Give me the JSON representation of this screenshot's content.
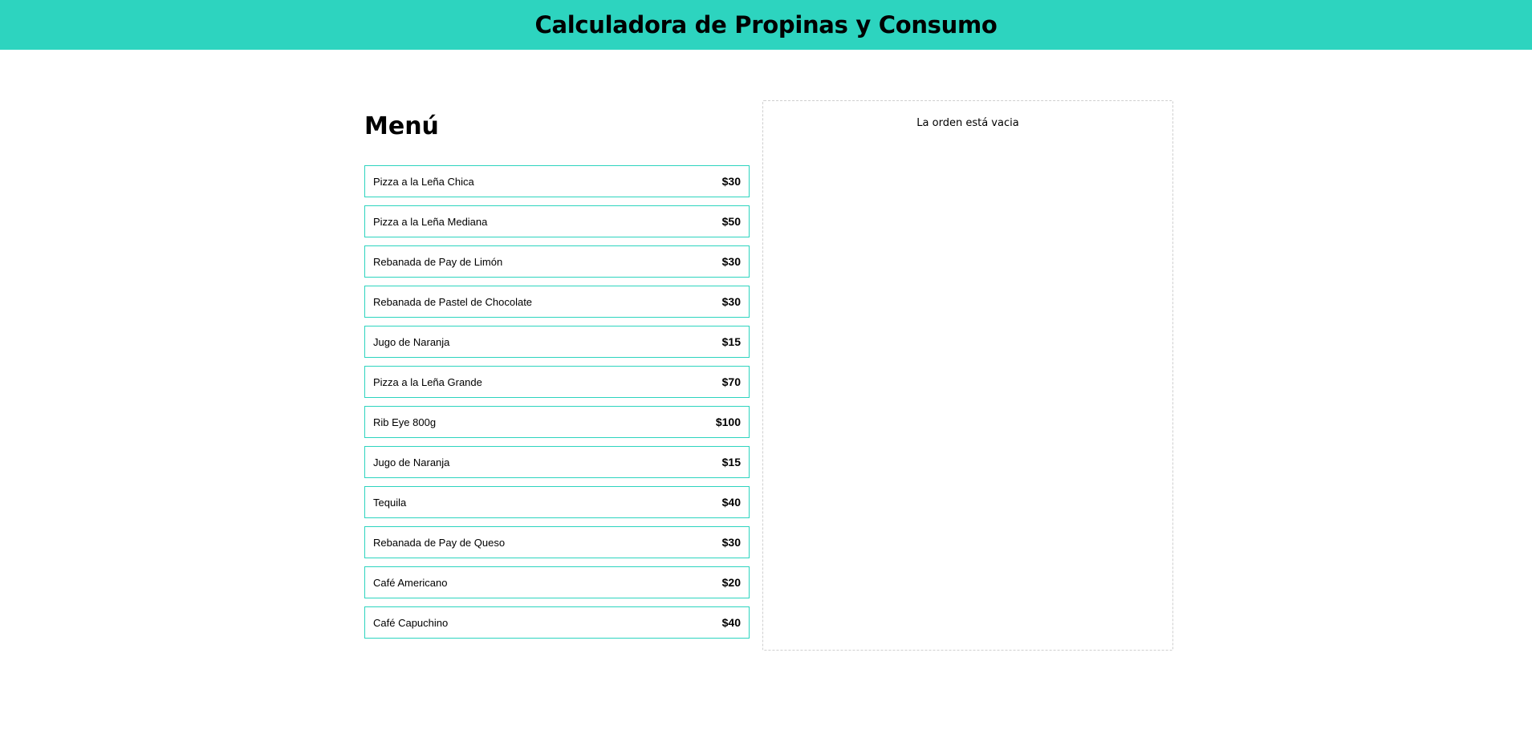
{
  "header": {
    "title": "Calculadora de Propinas y Consumo",
    "background_color": "#2dd4bf"
  },
  "menu": {
    "title": "Menú",
    "border_color": "#2dd4bf",
    "items": [
      {
        "name": "Pizza a la Leña Chica",
        "price": "$30"
      },
      {
        "name": "Pizza a la Leña Mediana",
        "price": "$50"
      },
      {
        "name": "Rebanada de Pay de Limón",
        "price": "$30"
      },
      {
        "name": "Rebanada de Pastel de Chocolate",
        "price": "$30"
      },
      {
        "name": "Jugo de Naranja",
        "price": "$15"
      },
      {
        "name": "Pizza a la Leña Grande",
        "price": "$70"
      },
      {
        "name": "Rib Eye 800g",
        "price": "$100"
      },
      {
        "name": "Jugo de Naranja",
        "price": "$15"
      },
      {
        "name": "Tequila",
        "price": "$40"
      },
      {
        "name": "Rebanada de Pay de Queso",
        "price": "$30"
      },
      {
        "name": "Café Americano",
        "price": "$20"
      },
      {
        "name": "Café Capuchino",
        "price": "$40"
      }
    ]
  },
  "order": {
    "empty_message": "La orden está vacia"
  }
}
